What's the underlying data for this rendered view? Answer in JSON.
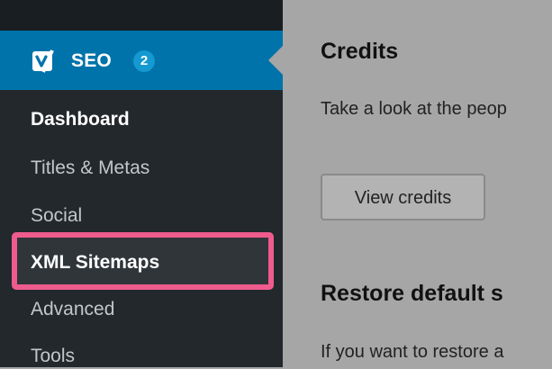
{
  "sidebar": {
    "seo": {
      "label": "SEO",
      "badge": "2"
    },
    "items": [
      {
        "label": "Dashboard"
      },
      {
        "label": "Titles & Metas"
      },
      {
        "label": "Social"
      },
      {
        "label": "XML Sitemaps"
      },
      {
        "label": "Advanced"
      },
      {
        "label": "Tools"
      }
    ]
  },
  "main": {
    "credits": {
      "title": "Credits",
      "description": "Take a look at the peop",
      "button_label": "View credits"
    },
    "restore": {
      "title": "Restore default s",
      "description": "If you want to restore a"
    }
  },
  "colors": {
    "sidebar_bg": "#23282d",
    "active_menu_bg": "#0073aa",
    "badge_bg": "#1599d1",
    "highlight_border": "#ef5b8d",
    "content_bg": "#a6a6a6"
  }
}
